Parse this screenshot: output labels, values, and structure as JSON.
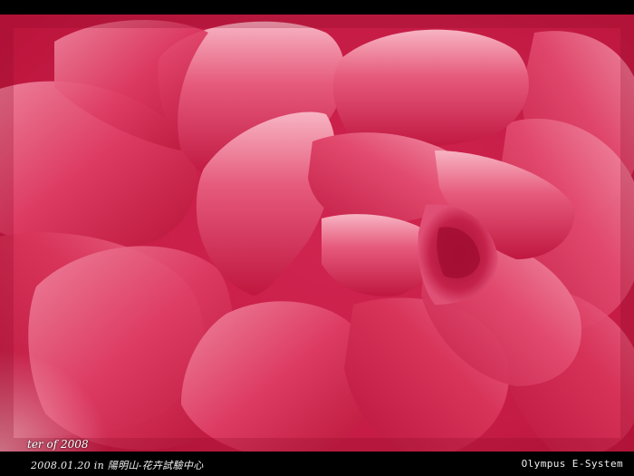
{
  "photo": {
    "subject": "pink-camellia-flower",
    "overlay_text": "ter of 2008",
    "colors": {
      "petal_dark": "#b8143c",
      "petal_mid": "#d93159",
      "petal_light": "#f17a94",
      "highlight": "#fbd0da",
      "frame": "#000000"
    }
  },
  "caption": {
    "left": "2008.01.20 in 陽明山-花卉試驗中心",
    "right": "Olympus E-System"
  }
}
